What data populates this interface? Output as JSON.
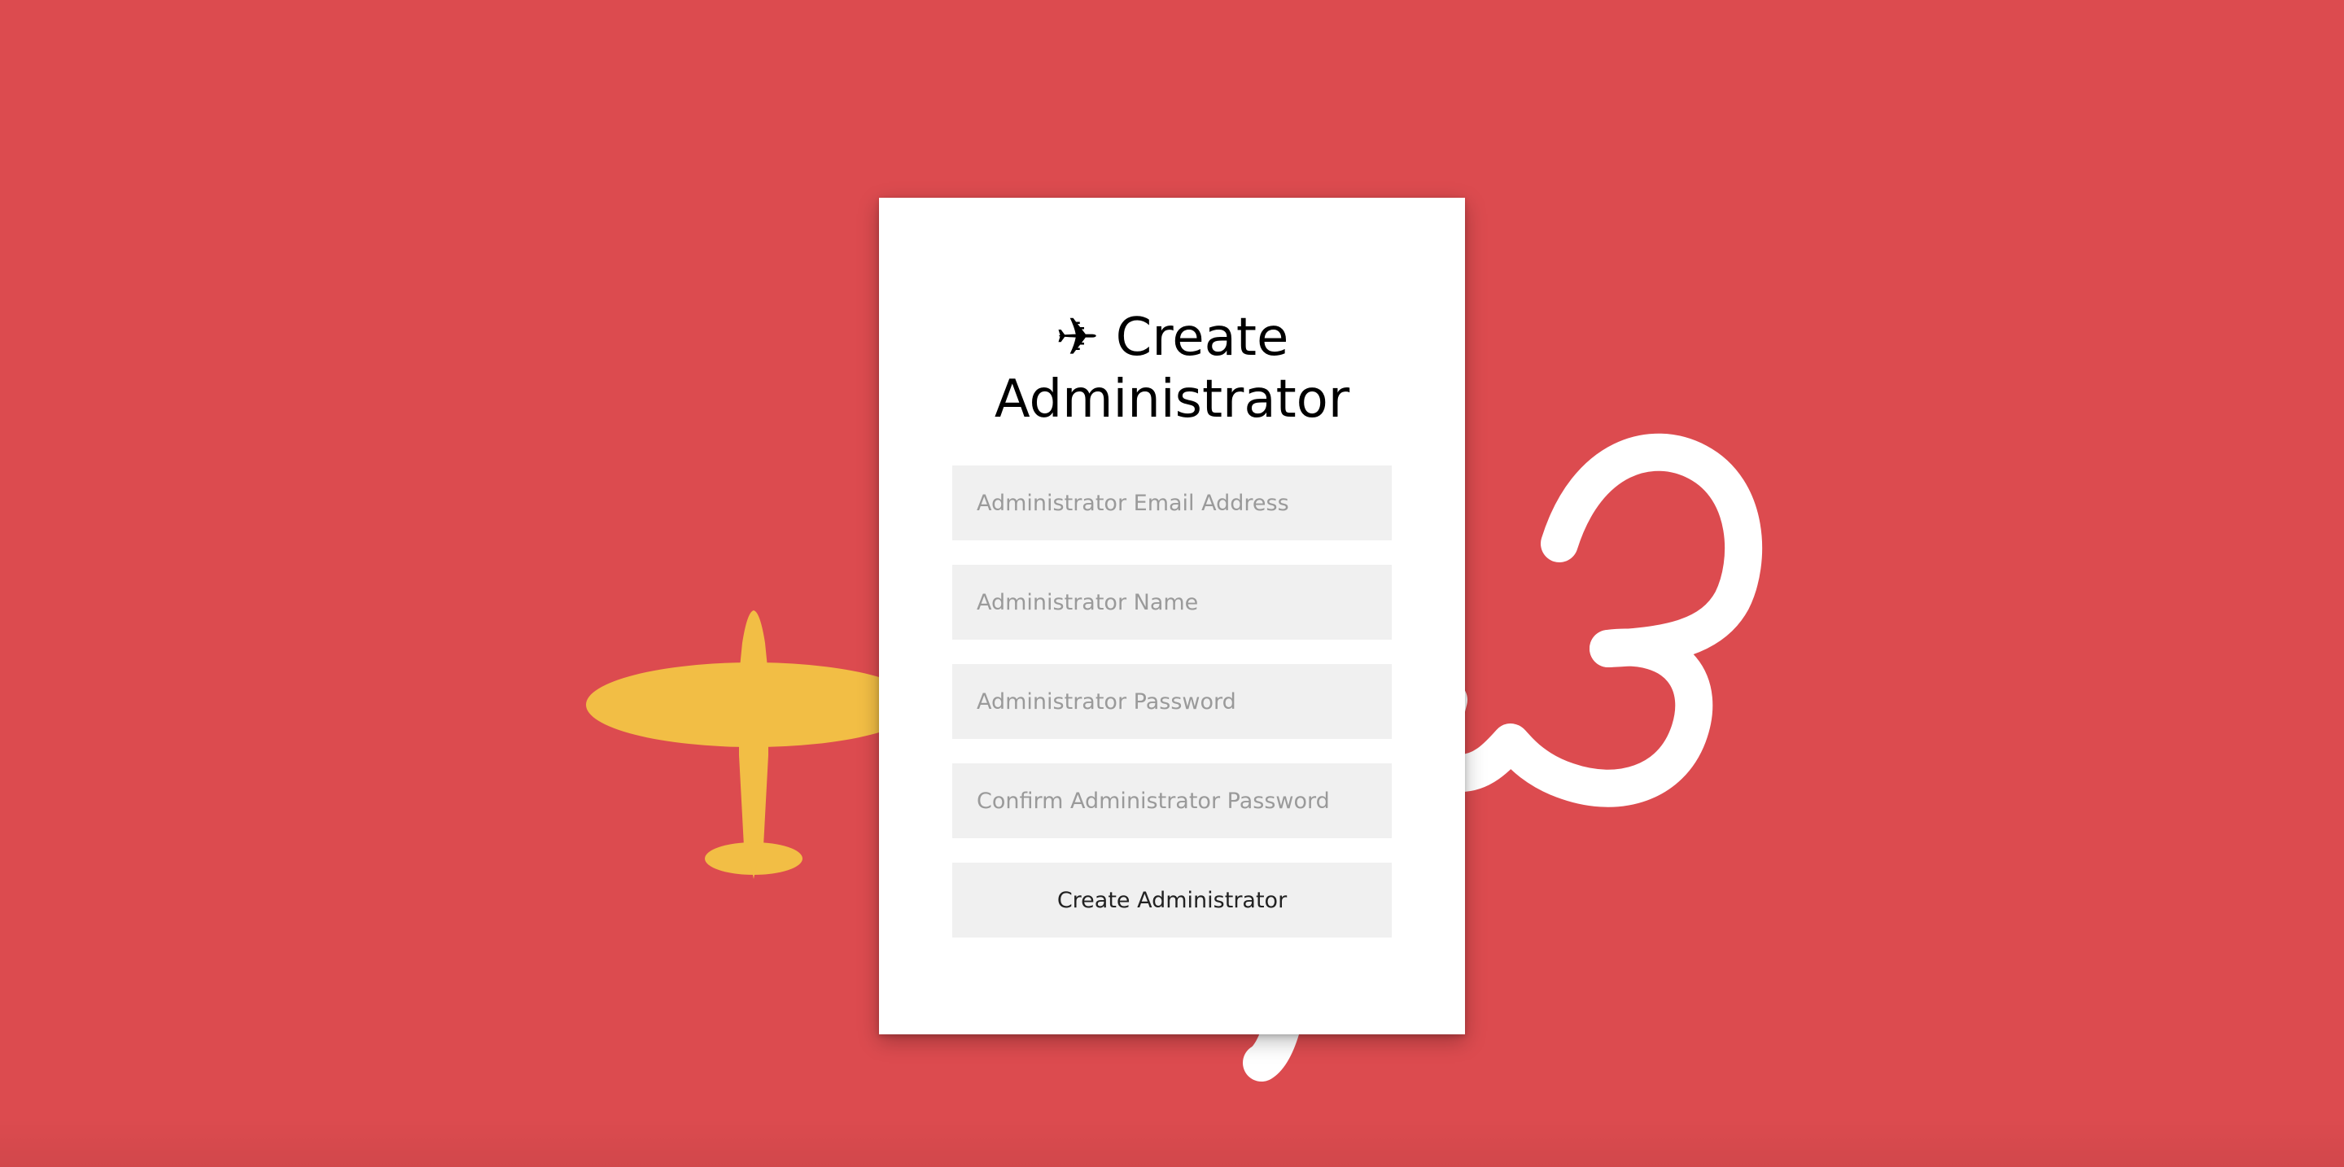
{
  "background": {
    "color": "#dc4b4f",
    "plane_color": "#f2be45",
    "doodle_color": "#ffffff"
  },
  "form": {
    "title_icon": "✈",
    "title_text": "Create Administrator",
    "email_placeholder": "Administrator Email Address",
    "name_placeholder": "Administrator Name",
    "password_placeholder": "Administrator Password",
    "confirm_password_placeholder": "Confirm Administrator Password",
    "submit_label": "Create Administrator"
  }
}
